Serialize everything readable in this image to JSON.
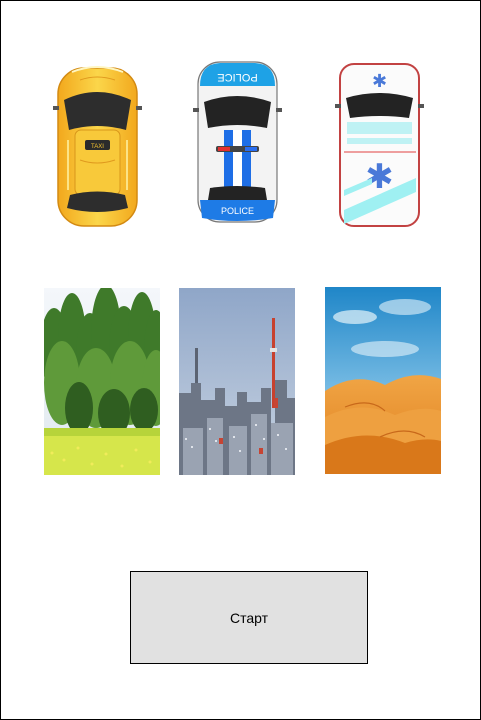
{
  "vehicles": [
    {
      "name": "taxi",
      "icon": "taxi-car-icon",
      "body_color": "#f7c531",
      "sign_text": ""
    },
    {
      "name": "police",
      "icon": "police-car-icon",
      "body_color": "#1fa6e8",
      "roof_text": "POLICE",
      "bumper_text": "POLICE"
    },
    {
      "name": "ambulance",
      "icon": "ambulance-car-icon",
      "body_color": "#ffffff",
      "accent_color": "#5fd6e6"
    }
  ],
  "scenes": [
    {
      "name": "forest",
      "icon": "forest-scene-image"
    },
    {
      "name": "city",
      "icon": "city-scene-image"
    },
    {
      "name": "desert",
      "icon": "desert-scene-image"
    }
  ],
  "start_button": {
    "label": "Старт"
  },
  "colors": {
    "button_bg": "#e1e1e1",
    "border": "#000000"
  }
}
